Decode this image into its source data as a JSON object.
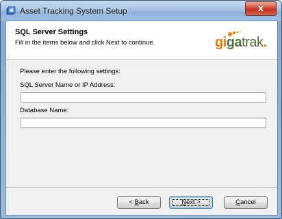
{
  "window": {
    "title": "Asset Tracking System Setup",
    "close_glyph": "x"
  },
  "header": {
    "title": "SQL Server Settings",
    "subtitle": "Fill in the items below and click Next to continue.",
    "logo": {
      "pre": "g",
      "mid_dot": "i",
      "brand": "ga",
      "suffix": "trak",
      "dot": "."
    }
  },
  "form": {
    "instruction": "Please enter the following settings:",
    "server_label": "SQL Server Name or IP Address:",
    "server_value": "",
    "database_label": "Database Name:",
    "database_value": ""
  },
  "buttons": {
    "back": {
      "mnemonic": "B",
      "rest": "ack",
      "prefix": "< "
    },
    "next": {
      "mnemonic": "N",
      "rest": "ext",
      "suffix": " >"
    },
    "cancel": {
      "mnemonic": "C",
      "rest": "ancel"
    }
  },
  "colors": {
    "logo_orange": "#f07c00",
    "logo_green": "#4f6f3c",
    "close_red": "#c2301b"
  }
}
